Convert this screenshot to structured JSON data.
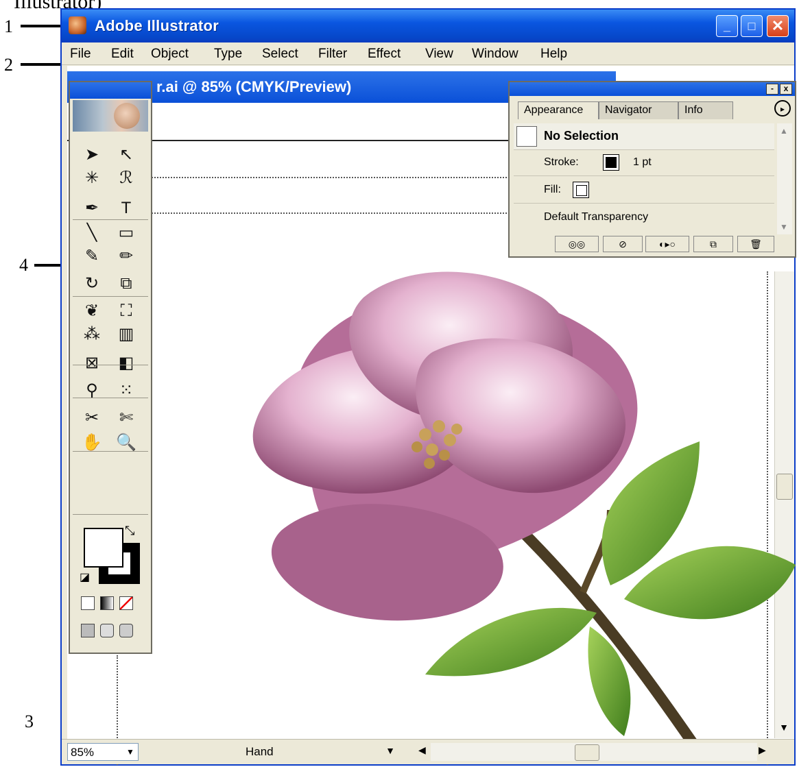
{
  "caption_fragment": "Illustrator)",
  "callouts": [
    {
      "label": "1"
    },
    {
      "label": "2"
    },
    {
      "label": "3"
    },
    {
      "label": "4"
    }
  ],
  "window": {
    "title": "Adobe Illustrator",
    "controls": {
      "minimize": "_",
      "maximize": "□",
      "close": "✕"
    }
  },
  "menubar": {
    "items": [
      "File",
      "Edit",
      "Object",
      "Type",
      "Select",
      "Filter",
      "Effect",
      "View",
      "Window",
      "Help"
    ]
  },
  "document": {
    "title": "r.ai @ 85% (CMYK/Preview)"
  },
  "palette": {
    "tabs": [
      "Appearance",
      "Navigator",
      "Info"
    ],
    "selection": "No Selection",
    "stroke_label": "Stroke:",
    "stroke_weight": "1 pt",
    "fill_label": "Fill:",
    "transparency": "Default Transparency",
    "controls": {
      "minimize": "-",
      "close": "x"
    }
  },
  "statusbar": {
    "zoom": "85%",
    "tool": "Hand"
  },
  "icons": {
    "menu_arrow": "▸",
    "scroll_up": "▲",
    "scroll_down": "▼",
    "scroll_left": "◀",
    "scroll_right": "▶",
    "dropdown": "▼"
  },
  "tools": [
    {
      "name": "selection-tool-icon",
      "glyph": "➤"
    },
    {
      "name": "direct-selection-tool-icon",
      "glyph": "↖"
    },
    {
      "name": "magic-wand-tool-icon",
      "glyph": "✳"
    },
    {
      "name": "lasso-tool-icon",
      "glyph": "ℛ"
    },
    {
      "name": "pen-tool-icon",
      "glyph": "✒"
    },
    {
      "name": "type-tool-icon",
      "glyph": "T"
    },
    {
      "name": "line-tool-icon",
      "glyph": "╲"
    },
    {
      "name": "rectangle-tool-icon",
      "glyph": "▭"
    },
    {
      "name": "paintbrush-tool-icon",
      "glyph": "✎"
    },
    {
      "name": "pencil-tool-icon",
      "glyph": "✏"
    },
    {
      "name": "rotate-tool-icon",
      "glyph": "↻"
    },
    {
      "name": "scale-tool-icon",
      "glyph": "⧉"
    },
    {
      "name": "warp-tool-icon",
      "glyph": "❦"
    },
    {
      "name": "free-transform-tool-icon",
      "glyph": "⛶"
    },
    {
      "name": "symbol-sprayer-tool-icon",
      "glyph": "⁂"
    },
    {
      "name": "graph-tool-icon",
      "glyph": "▥"
    },
    {
      "name": "mesh-tool-icon",
      "glyph": "⊠"
    },
    {
      "name": "gradient-tool-icon",
      "glyph": "◧"
    },
    {
      "name": "eyedropper-tool-icon",
      "glyph": "⚲"
    },
    {
      "name": "blend-tool-icon",
      "glyph": "⁙"
    },
    {
      "name": "slice-tool-icon",
      "glyph": "✂"
    },
    {
      "name": "scissors-tool-icon",
      "glyph": "✄"
    },
    {
      "name": "hand-tool-icon",
      "glyph": "✋"
    },
    {
      "name": "zoom-tool-icon",
      "glyph": "🔍"
    }
  ],
  "colors": {
    "titlebar": "#0a56e0",
    "window_bg": "#ece9d8",
    "petal_light": "#f3d6e6",
    "petal_mid": "#d9a0c0",
    "petal_dark": "#8e4a72",
    "leaf": "#6aa52a",
    "stem": "#4a3c24",
    "stamen": "#c8a15a"
  }
}
